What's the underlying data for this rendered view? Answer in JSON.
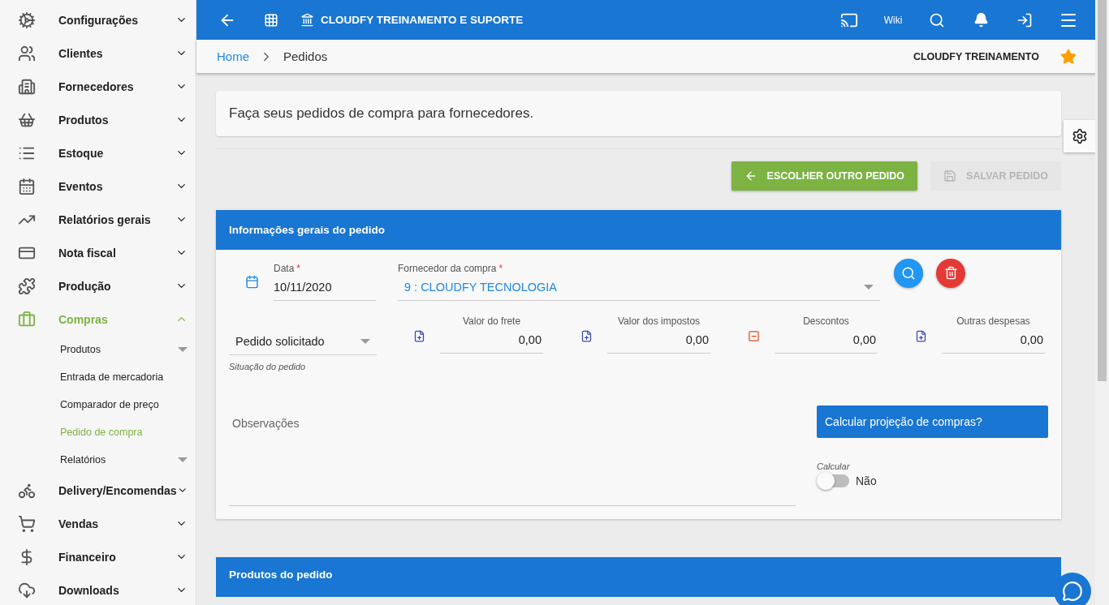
{
  "sidebar": {
    "items": [
      {
        "label": "Configurações",
        "expanded": false,
        "selected": false
      },
      {
        "label": "Clientes",
        "expanded": false,
        "selected": false
      },
      {
        "label": "Fornecedores",
        "expanded": false,
        "selected": false
      },
      {
        "label": "Produtos",
        "expanded": false,
        "selected": false
      },
      {
        "label": "Estoque",
        "expanded": false,
        "selected": false
      },
      {
        "label": "Eventos",
        "expanded": false,
        "selected": false
      },
      {
        "label": "Relatórios gerais",
        "expanded": false,
        "selected": false
      },
      {
        "label": "Nota fiscal",
        "expanded": false,
        "selected": false
      },
      {
        "label": "Produção",
        "expanded": false,
        "selected": false
      },
      {
        "label": "Compras",
        "expanded": true,
        "selected": true,
        "children": [
          {
            "label": "Produtos",
            "selected": false,
            "has_submenu": true
          },
          {
            "label": "Entrada de mercadoria",
            "selected": false,
            "has_submenu": false
          },
          {
            "label": "Comparador de preço",
            "selected": false,
            "has_submenu": false
          },
          {
            "label": "Pedido de compra",
            "selected": true,
            "has_submenu": false
          },
          {
            "label": "Relatórios",
            "selected": false,
            "has_submenu": true
          }
        ]
      },
      {
        "label": "Delivery/Encomendas",
        "expanded": false,
        "selected": false
      },
      {
        "label": "Vendas",
        "expanded": false,
        "selected": false
      },
      {
        "label": "Financeiro",
        "expanded": false,
        "selected": false
      },
      {
        "label": "Downloads",
        "expanded": false,
        "selected": false
      }
    ]
  },
  "topbar": {
    "title": "CLOUDFY TREINAMENTO E SUPORTE",
    "wiki": "Wiki"
  },
  "breadcrumb": {
    "items": [
      "Home",
      "Pedidos"
    ],
    "company": "CLOUDFY TREINAMENTO",
    "favorite": true
  },
  "intro": "Faça seus pedidos de compra para fornecedores.",
  "actions": [
    {
      "label": "ESCOLHER OUTRO PEDIDO",
      "kind": "back",
      "disabled": false
    },
    {
      "label": "SALVAR PEDIDO",
      "kind": "save",
      "disabled": true
    }
  ],
  "section": {
    "title": "Informações gerais do pedido",
    "date": {
      "label": "Data",
      "required_mark": "*",
      "value": "10/11/2020"
    },
    "supplier": {
      "label": "Fornecedor da compra",
      "required_mark": "*",
      "value": "9 : CLOUDFY TECNOLOGIA"
    },
    "status": {
      "value": "Pedido solicitado",
      "hint": "Situação do pedido"
    },
    "amounts": [
      {
        "label": "Valor do frete",
        "value": "0,00",
        "kind": "plus"
      },
      {
        "label": "Valor dos impostos",
        "value": "0,00",
        "kind": "plus"
      },
      {
        "label": "Descontos",
        "value": "0,00",
        "kind": "minus"
      },
      {
        "label": "Outras despesas",
        "value": "0,00",
        "kind": "plus"
      }
    ],
    "notes": {
      "placeholder": "Observações"
    },
    "projection": {
      "title": "Calcular projeção de compras?",
      "toggle_label": "Calcular",
      "on": false,
      "state_text": "Não"
    }
  },
  "next_section": {
    "title": "Produtos do pedido"
  }
}
